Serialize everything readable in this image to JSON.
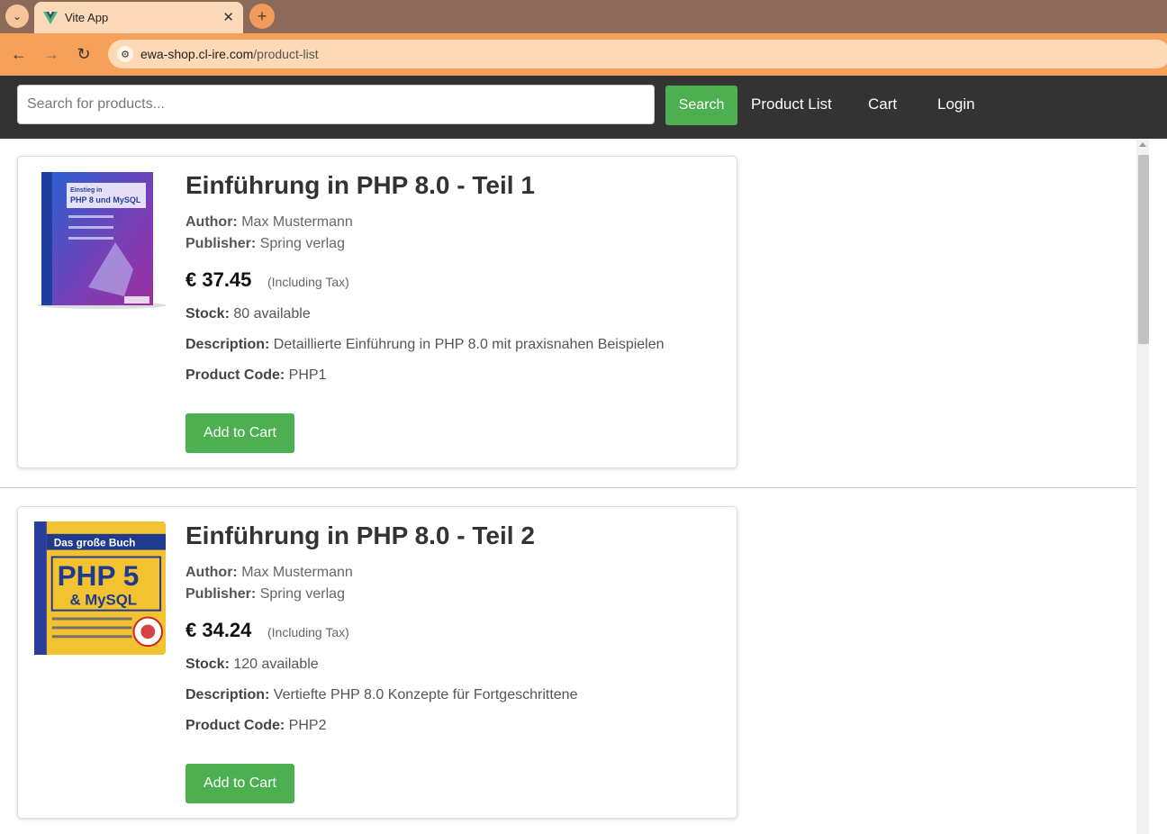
{
  "browser": {
    "tab_title": "Vite App",
    "url_host": "ewa-shop.cl-ire.com",
    "url_path": "/product-list"
  },
  "navbar": {
    "search_placeholder": "Search for products...",
    "search_label": "Search",
    "links": [
      "Product List",
      "Cart",
      "Login"
    ]
  },
  "labels": {
    "author": "Author:",
    "publisher": "Publisher:",
    "tax_note": "(Including Tax)",
    "stock": "Stock:",
    "description": "Description:",
    "product_code": "Product Code:",
    "add_to_cart": "Add to Cart"
  },
  "products": [
    {
      "title": "Einführung in PHP 8.0 - Teil 1",
      "author": "Max Mustermann",
      "publisher": "Spring verlag",
      "price": "€ 37.45",
      "stock": "80 available",
      "description": "Detaillierte Einführung in PHP 8.0 mit praxisnahen Beispielen",
      "code": "PHP1",
      "cover": {
        "line1": "Einstieg in",
        "line2": "PHP 8 und MySQL",
        "colors": [
          "#2b5fd1",
          "#7a3fb5",
          "#9c2fa0"
        ]
      }
    },
    {
      "title": "Einführung in PHP 8.0 - Teil 2",
      "author": "Max Mustermann",
      "publisher": "Spring verlag",
      "price": "€ 34.24",
      "stock": "120 available",
      "description": "Vertiefte PHP 8.0 Konzepte für Fortgeschrittene",
      "code": "PHP2",
      "cover": {
        "line1": "Das große Buch",
        "line2": "PHP 5",
        "line3": "& MySQL",
        "colors": [
          "#1f3a8f",
          "#f2c230"
        ]
      }
    }
  ]
}
